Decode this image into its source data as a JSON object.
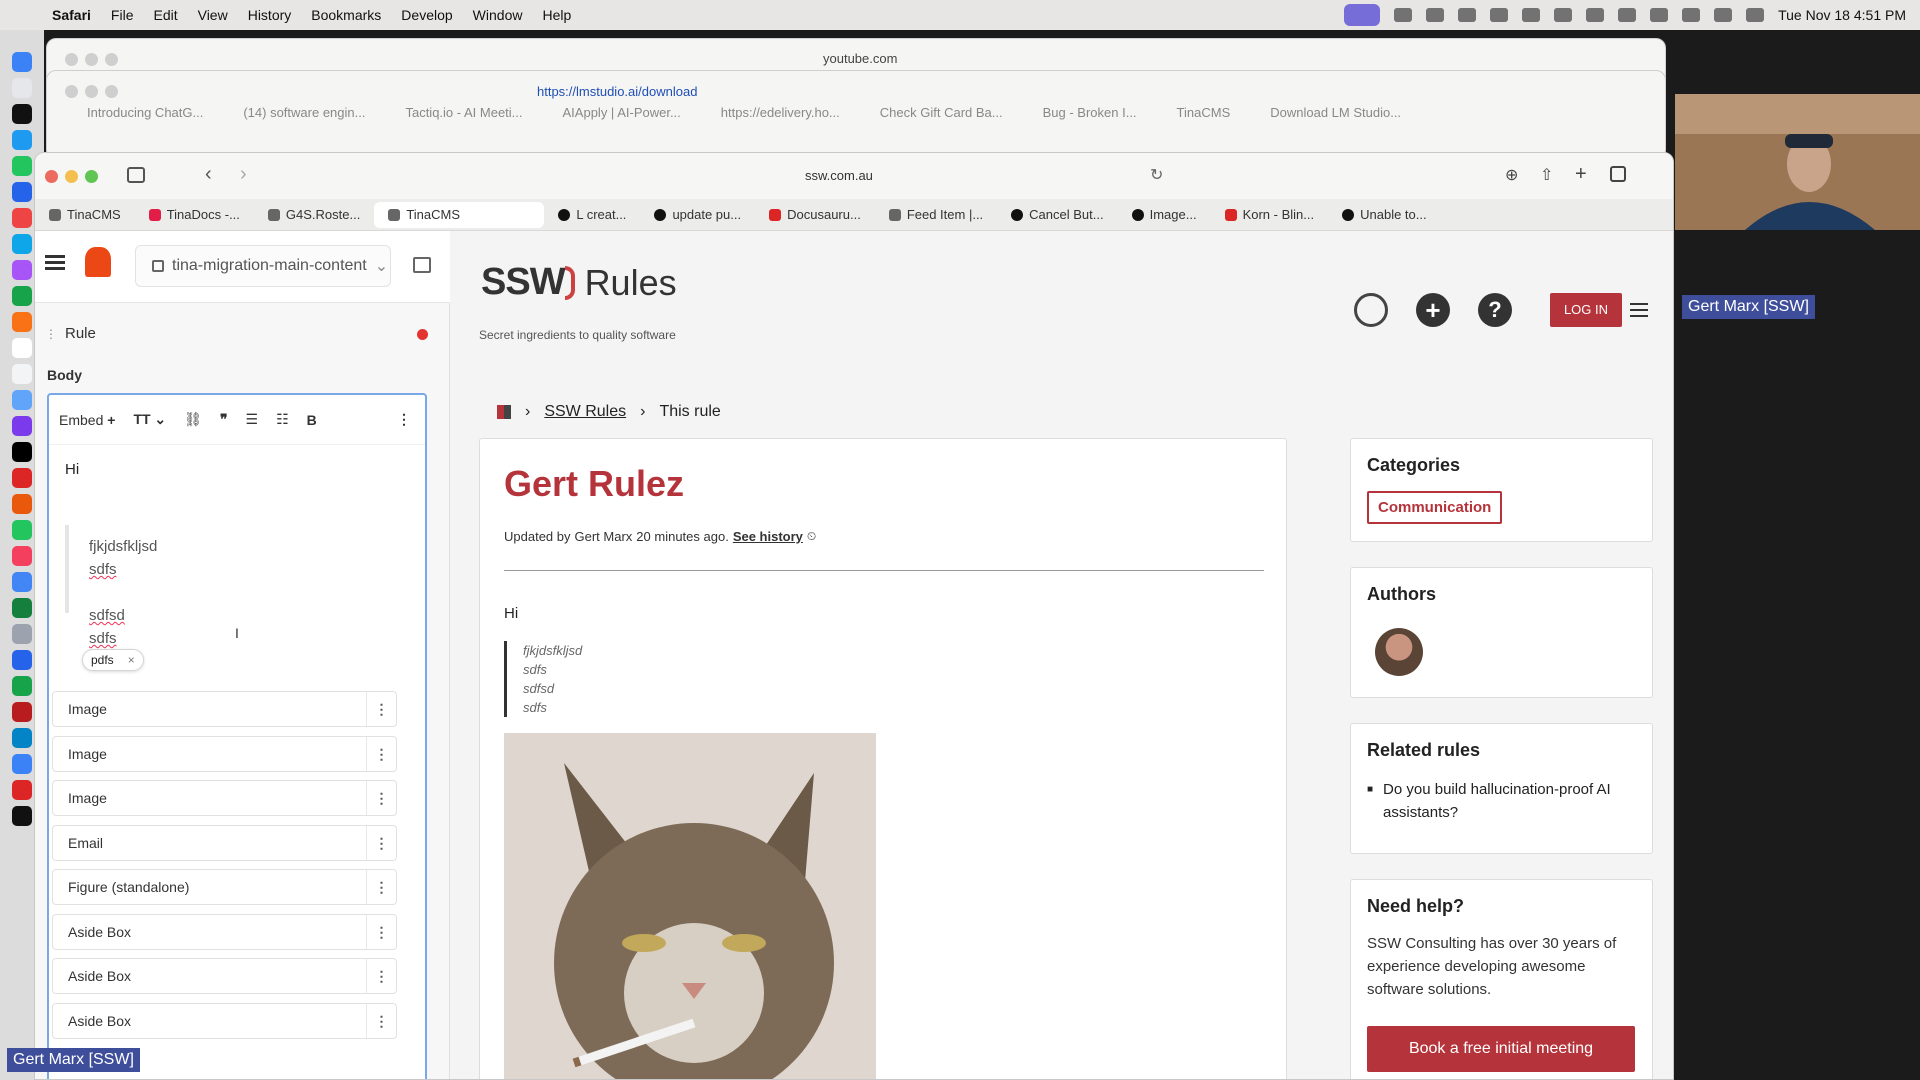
{
  "menubar": {
    "app": "Safari",
    "items": [
      "File",
      "Edit",
      "View",
      "History",
      "Bookmarks",
      "Develop",
      "Window",
      "Help"
    ],
    "clock": "Tue Nov 18  4:51 PM"
  },
  "bg_windows": {
    "win1_url": "youtube.com",
    "win2_url": "https://lmstudio.ai/download",
    "win2_tabs": [
      "Introducing ChatG...",
      "(14) software engin...",
      "Tactiq.io - AI Meeti...",
      "AIApply | AI-Power...",
      "https://edelivery.ho...",
      "Check Gift Card Ba...",
      "Bug - Broken I...",
      "TinaCMS",
      "Download LM Studio..."
    ]
  },
  "main_window": {
    "url": "ssw.com.au",
    "tabs": [
      "TinaCMS",
      "TinaDocs -...",
      "G4S.Roste...",
      "TinaCMS",
      "L  creat...",
      "update pu...",
      "Docusauru...",
      "Feed Item |...",
      "Cancel But...",
      "Image...",
      "Korn - Blin...",
      "Unable to..."
    ]
  },
  "tina": {
    "branch": "tina-migration-main-content",
    "collection": "Rule",
    "field_label": "Body",
    "toolbar": {
      "embed": "Embed",
      "bold": "B"
    },
    "content": {
      "para": "Hi",
      "quote": [
        "fjkjdsfkljsd",
        "sdfs",
        "sdfsd",
        "sdfs"
      ],
      "chip": "pdfs"
    },
    "blocks": [
      "Image",
      "Image",
      "Image",
      "Email",
      "Figure (standalone)",
      "Aside Box",
      "Aside Box",
      "Aside Box"
    ]
  },
  "ssw": {
    "logo_text": "Rules",
    "tagline": "Secret ingredients to quality software",
    "login": "LOG IN",
    "breadcrumb": [
      "SSW Rules",
      "This rule"
    ],
    "rule": {
      "title": "Gert Rulez",
      "updated_prefix": "Updated by",
      "author": "Gert Marx",
      "ago": "20 minutes ago.",
      "history": "See history",
      "body_para": "Hi",
      "quote": [
        "fjkjdsfkljsd",
        "sdfs",
        "sdfsd",
        "sdfs"
      ]
    },
    "categories": {
      "title": "Categories",
      "item": "Communication"
    },
    "authors": {
      "title": "Authors"
    },
    "related": {
      "title": "Related rules",
      "item": "Do you build hallucination-proof AI assistants?"
    },
    "help": {
      "title": "Need help?",
      "text": "SSW Consulting has over 30 years of experience developing awesome software solutions.",
      "button": "Book a free initial meeting"
    }
  },
  "video": {
    "name_tag": "Gert Marx [SSW]",
    "bottom_tag": "Gert Marx [SSW]"
  },
  "colors": {
    "ssw_red": "#b5333a",
    "menubar": "#e8e6e4",
    "focus": "#7aa7e8"
  }
}
